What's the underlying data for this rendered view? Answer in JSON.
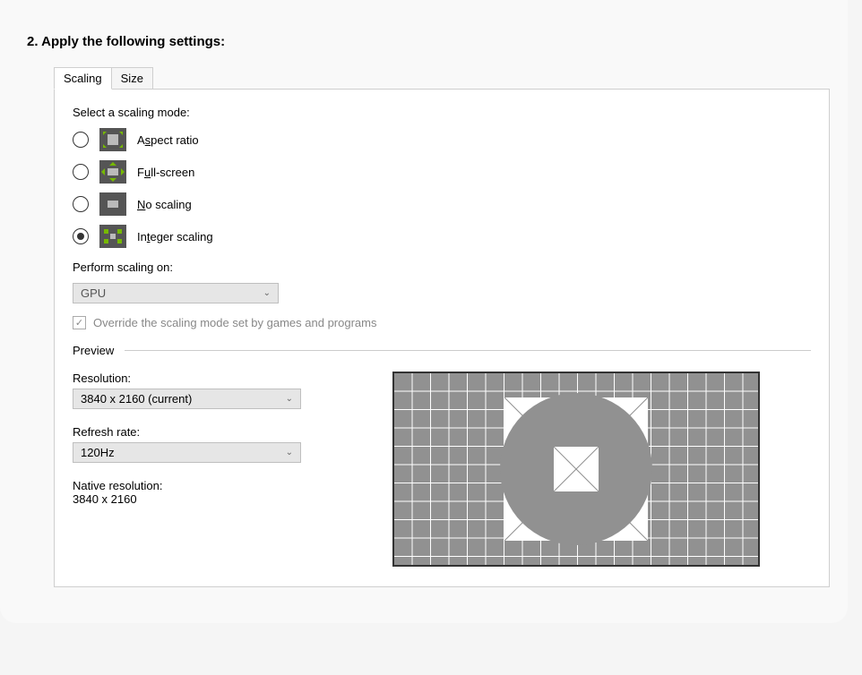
{
  "heading": "2. Apply the following settings:",
  "tabs": {
    "scaling": "Scaling",
    "size": "Size"
  },
  "section": {
    "select_mode_label": "Select a scaling mode:",
    "modes": {
      "aspect_pre": "A",
      "aspect_key": "s",
      "aspect_post": "pect ratio",
      "full_pre": "F",
      "full_key": "u",
      "full_post": "ll-screen",
      "noscale_key": "N",
      "noscale_post": "o scaling",
      "integer_pre": "In",
      "integer_key": "t",
      "integer_post": "eger scaling"
    },
    "perform_on_label": "Perform scaling on:",
    "perform_on_value": "GPU",
    "override_label": "Override the scaling mode set by games and programs",
    "preview_title": "Preview",
    "resolution_label": "Resolution:",
    "resolution_value": "3840 x 2160 (current)",
    "refresh_label": "Refresh rate:",
    "refresh_value": "120Hz",
    "native_label": "Native resolution:",
    "native_value": "3840 x 2160"
  }
}
